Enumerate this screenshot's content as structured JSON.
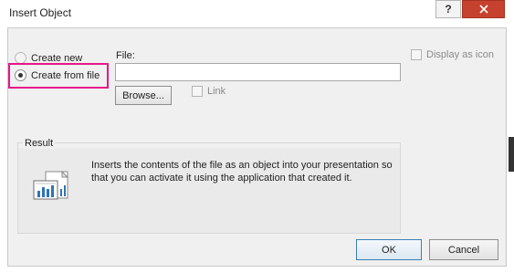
{
  "window": {
    "title": "Insert Object",
    "help_label": "?",
    "close_icon": "close-icon"
  },
  "options": {
    "create_new": "Create new",
    "create_from_file": "Create from file",
    "selected": "create_from_file"
  },
  "file": {
    "label": "File:",
    "value": "",
    "browse_label": "Browse...",
    "link_label": "Link",
    "link_checked": false
  },
  "display_as_icon": {
    "label": "Display as icon",
    "checked": false
  },
  "result": {
    "label": "Result",
    "text": "Inserts the contents of the file as an object into your presentation so that you can activate it using the application that created it.",
    "icon": "embedded-chart-icon"
  },
  "buttons": {
    "ok": "OK",
    "cancel": "Cancel"
  },
  "colors": {
    "highlight": "#e5178a",
    "close_button": "#c7412f"
  }
}
